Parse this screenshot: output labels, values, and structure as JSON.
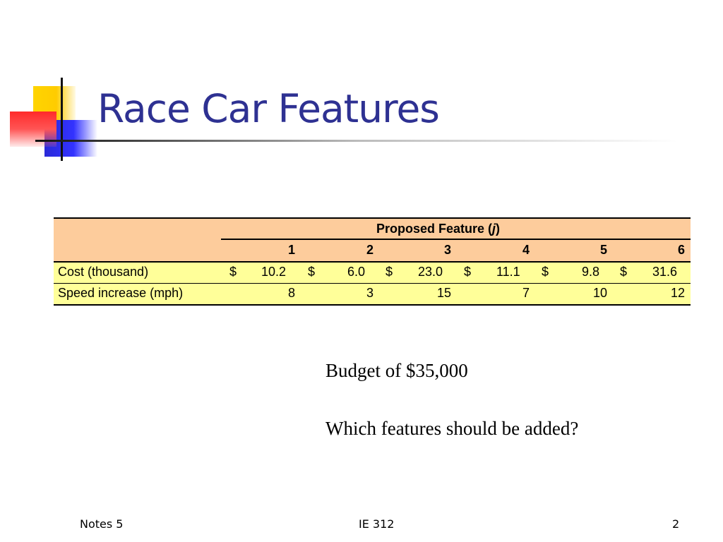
{
  "slide": {
    "title": "Race Car Features",
    "budget_text": "Budget of $35,000",
    "question_text": "Which features should be added?"
  },
  "table": {
    "group_header": "Proposed Feature (",
    "group_header_var": "j",
    "group_header_close": ")",
    "columns": [
      "1",
      "2",
      "3",
      "4",
      "5",
      "6"
    ],
    "rows": [
      {
        "label": "Cost (thousand)",
        "currency": "$",
        "values": [
          "10.2",
          "6.0",
          "23.0",
          "11.1",
          "9.8",
          "31.6"
        ]
      },
      {
        "label": "Speed increase (mph)",
        "values": [
          "8",
          "3",
          "15",
          "7",
          "10",
          "12"
        ]
      }
    ],
    "colors": {
      "header_bg": "#fdcc9c",
      "row_bg": "#ffff99"
    }
  },
  "footer": {
    "left": "Notes 5",
    "center": "IE 312",
    "page_number": "2"
  },
  "colors": {
    "title": "#2e3192"
  }
}
